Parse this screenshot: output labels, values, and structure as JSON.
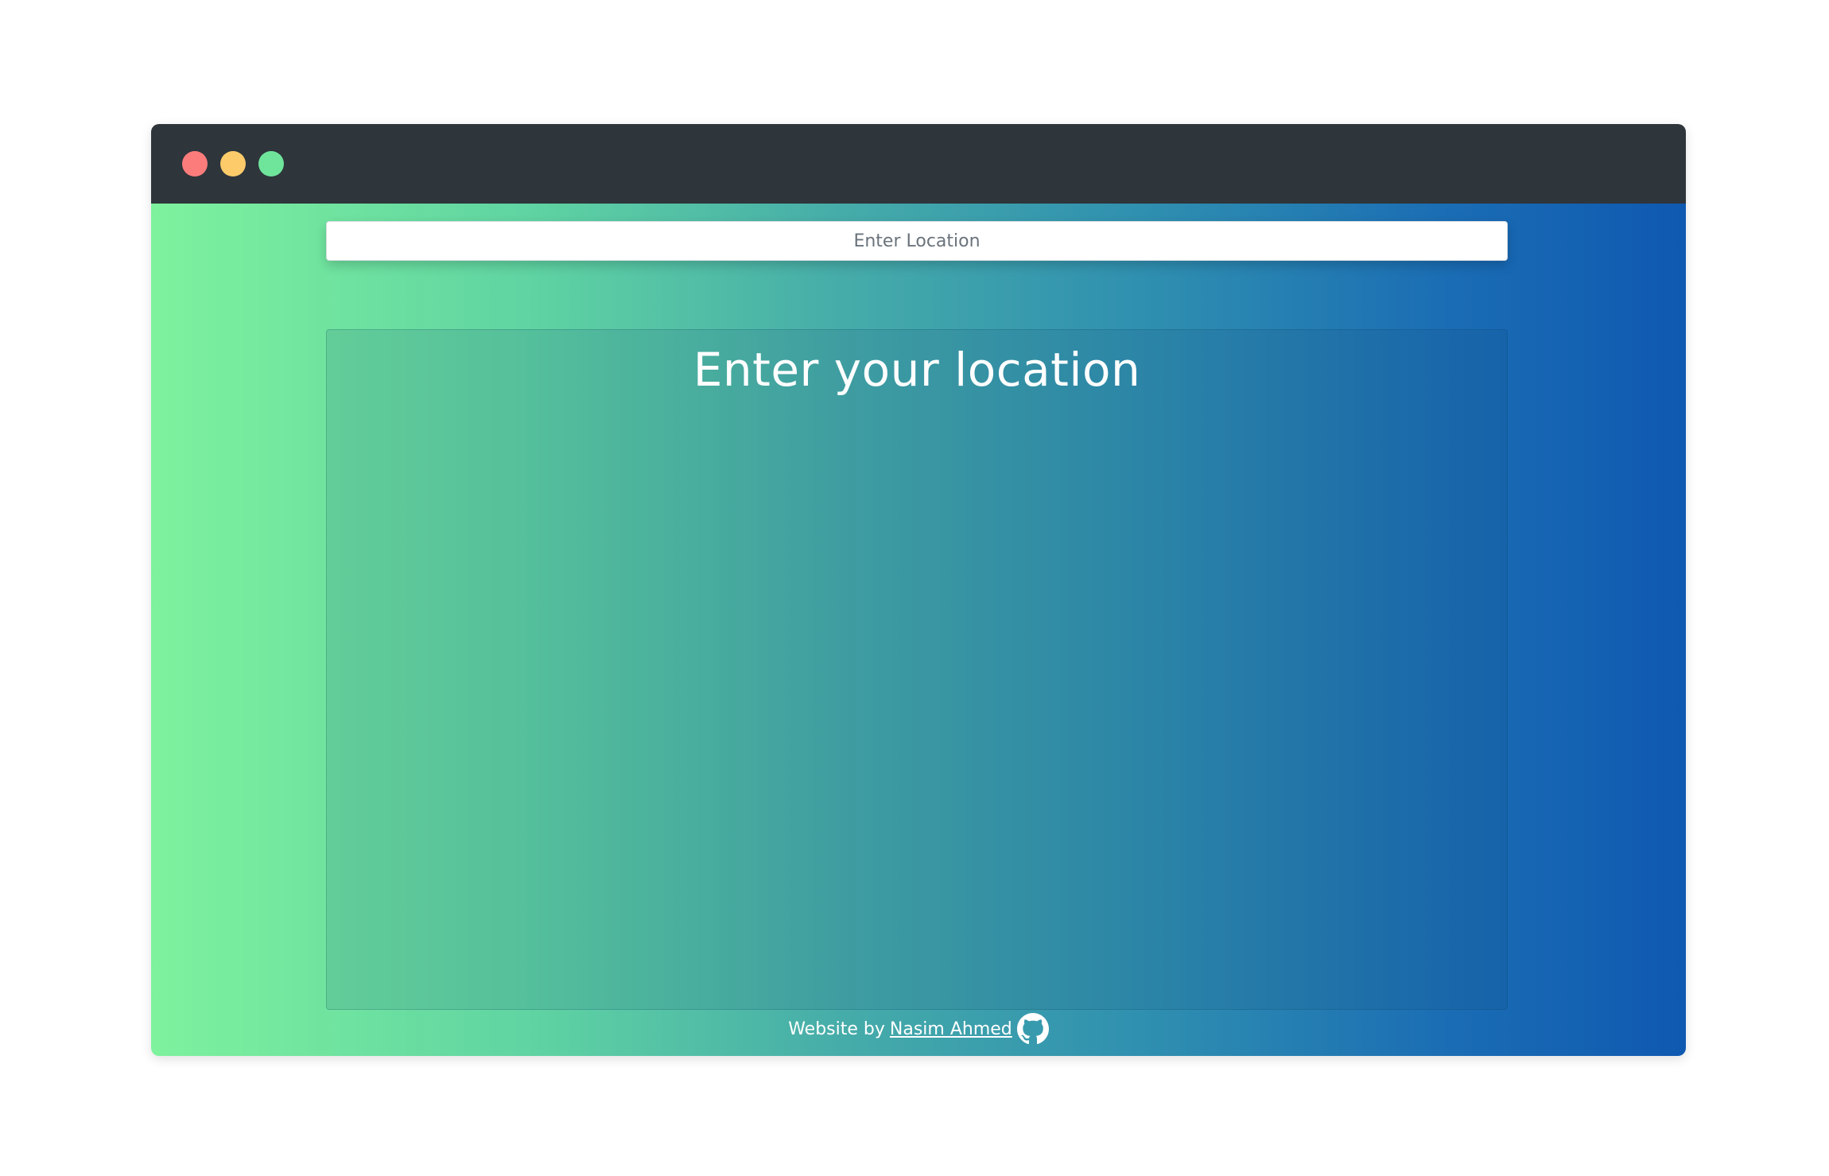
{
  "window": {
    "controls": {
      "close_color": "#fc7c7c",
      "minimize_color": "#fdcb6a",
      "maximize_color": "#6fe59b"
    }
  },
  "search": {
    "placeholder": "Enter Location",
    "value": ""
  },
  "panel": {
    "title": "Enter your location"
  },
  "footer": {
    "prefix": "Website by",
    "author_name": "Nasim Ahmed",
    "icon": "github-icon"
  },
  "colors": {
    "gradient_start": "#7ef29d",
    "gradient_end": "#0f59b1",
    "titlebar": "#2e353b"
  }
}
